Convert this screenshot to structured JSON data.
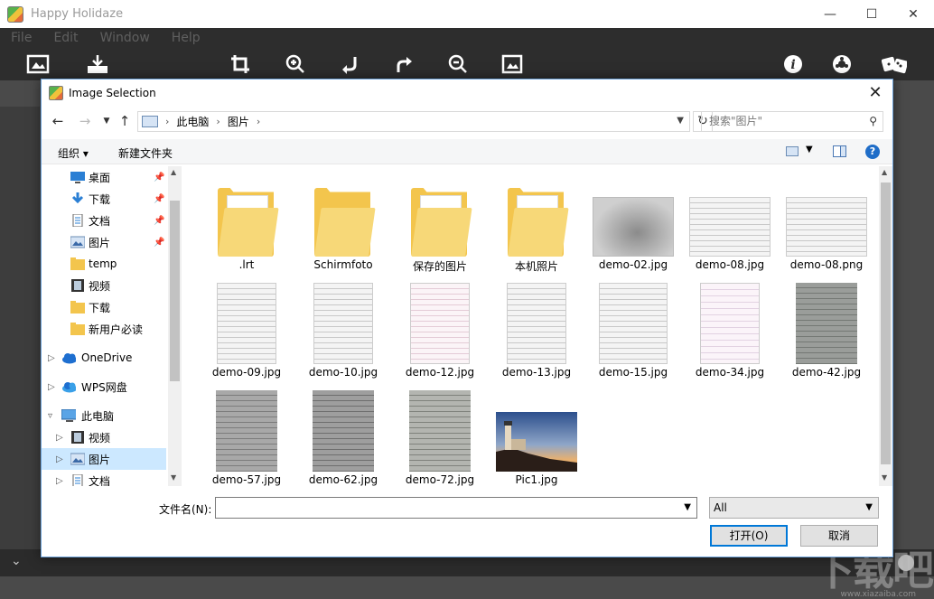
{
  "app": {
    "title": "Happy Holidaze",
    "menu": [
      "File",
      "Edit",
      "Window",
      "Help"
    ]
  },
  "dialog": {
    "title": "Image Selection",
    "breadcrumb": [
      "此电脑",
      "图片"
    ],
    "search_placeholder": "搜索\"图片\"",
    "organize": "组织 ▾",
    "new_folder": "新建文件夹",
    "help": "?",
    "nav_items": [
      {
        "label": "桌面",
        "icon": "desktop-icon",
        "pinned": true
      },
      {
        "label": "下载",
        "icon": "download-icon",
        "pinned": true
      },
      {
        "label": "文档",
        "icon": "document-icon",
        "pinned": true
      },
      {
        "label": "图片",
        "icon": "pictures-icon",
        "pinned": true
      },
      {
        "label": "temp",
        "icon": "folder-icon"
      },
      {
        "label": "视频",
        "icon": "video-icon"
      },
      {
        "label": "下载",
        "icon": "folder-icon"
      },
      {
        "label": "新用户必读",
        "icon": "folder-icon"
      },
      {
        "label": "OneDrive",
        "icon": "cloud-icon"
      },
      {
        "label": "WPS网盘",
        "icon": "cloud-icon"
      },
      {
        "label": "此电脑",
        "icon": "computer-icon"
      },
      {
        "label": "视频",
        "icon": "video-icon"
      },
      {
        "label": "图片",
        "icon": "pictures-icon",
        "selected": true
      },
      {
        "label": "文档",
        "icon": "document-icon"
      }
    ],
    "files": [
      {
        "name": ".lrt",
        "kind": "folder"
      },
      {
        "name": "Schirmfoto",
        "kind": "folder"
      },
      {
        "name": "保存的图片",
        "kind": "folder"
      },
      {
        "name": "本机照片",
        "kind": "folder"
      },
      {
        "name": "demo-02.jpg",
        "kind": "image"
      },
      {
        "name": "demo-08.jpg",
        "kind": "image"
      },
      {
        "name": "demo-08.png",
        "kind": "image"
      },
      {
        "name": "demo-09.jpg",
        "kind": "image"
      },
      {
        "name": "demo-10.jpg",
        "kind": "image"
      },
      {
        "name": "demo-12.jpg",
        "kind": "image"
      },
      {
        "name": "demo-13.jpg",
        "kind": "image"
      },
      {
        "name": "demo-15.jpg",
        "kind": "image"
      },
      {
        "name": "demo-34.jpg",
        "kind": "image"
      },
      {
        "name": "demo-42.jpg",
        "kind": "image"
      },
      {
        "name": "demo-57.jpg",
        "kind": "image"
      },
      {
        "name": "demo-62.jpg",
        "kind": "image"
      },
      {
        "name": "demo-72.jpg",
        "kind": "image"
      },
      {
        "name": "Pic1.jpg",
        "kind": "photo"
      }
    ],
    "filename_label": "文件名(N):",
    "filename_value": "",
    "filter_value": "All",
    "open_button": "打开(O)",
    "cancel_button": "取消"
  },
  "watermark": {
    "text": "下载吧",
    "url": "www.xiazaiba.com"
  }
}
